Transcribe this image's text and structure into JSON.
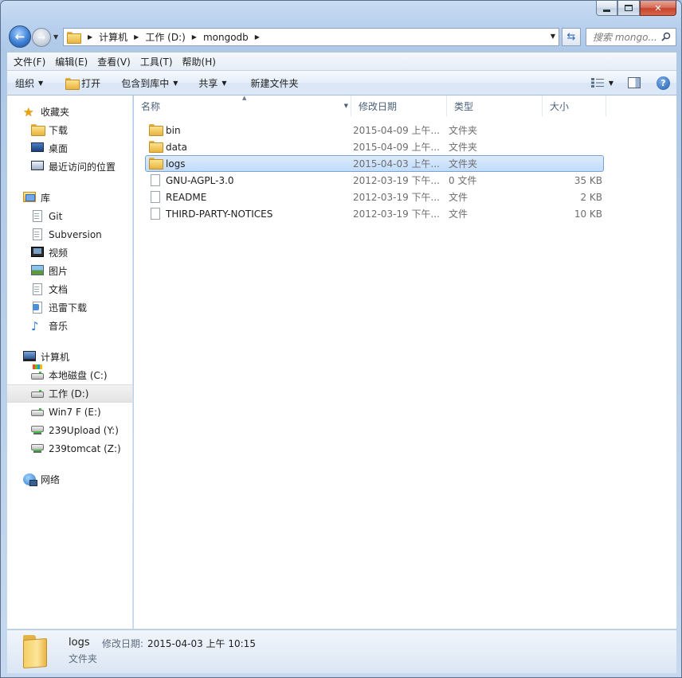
{
  "address": {
    "crumbs": [
      "计算机",
      "工作 (D:)",
      "mongodb"
    ]
  },
  "search": {
    "placeholder": "搜索 mongo..."
  },
  "menu": [
    "文件(F)",
    "编辑(E)",
    "查看(V)",
    "工具(T)",
    "帮助(H)"
  ],
  "toolbar": {
    "organize": "组织",
    "open": "打开",
    "include_library": "包含到库中",
    "share": "共享",
    "new_folder": "新建文件夹"
  },
  "nav": {
    "favorites": {
      "label": "收藏夹",
      "items": [
        "下载",
        "桌面",
        "最近访问的位置"
      ]
    },
    "libraries": {
      "label": "库",
      "items": [
        "Git",
        "Subversion",
        "视频",
        "图片",
        "文档",
        "迅雷下载",
        "音乐"
      ]
    },
    "computer": {
      "label": "计算机",
      "items": [
        "本地磁盘 (C:)",
        "工作 (D:)",
        "Win7 F (E:)",
        "239Upload (Y:)",
        "239tomcat (Z:)"
      ]
    },
    "network": {
      "label": "网络"
    }
  },
  "columns": {
    "name": "名称",
    "date": "修改日期",
    "type": "类型",
    "size": "大小"
  },
  "files": [
    {
      "name": "bin",
      "date": "2015-04-09 上午...",
      "type": "文件夹",
      "size": "",
      "kind": "folder"
    },
    {
      "name": "data",
      "date": "2015-04-09 上午...",
      "type": "文件夹",
      "size": "",
      "kind": "folder"
    },
    {
      "name": "logs",
      "date": "2015-04-03 上午...",
      "type": "文件夹",
      "size": "",
      "kind": "folder",
      "selected": true
    },
    {
      "name": "GNU-AGPL-3.0",
      "date": "2012-03-19 下午...",
      "type": "0 文件",
      "size": "35 KB",
      "kind": "file"
    },
    {
      "name": "README",
      "date": "2012-03-19 下午...",
      "type": "文件",
      "size": "2 KB",
      "kind": "file"
    },
    {
      "name": "THIRD-PARTY-NOTICES",
      "date": "2012-03-19 下午...",
      "type": "文件",
      "size": "10 KB",
      "kind": "file"
    }
  ],
  "details": {
    "name": "logs",
    "meta_label": "修改日期:",
    "meta_value": "2015-04-03 上午 10:15",
    "type": "文件夹"
  }
}
